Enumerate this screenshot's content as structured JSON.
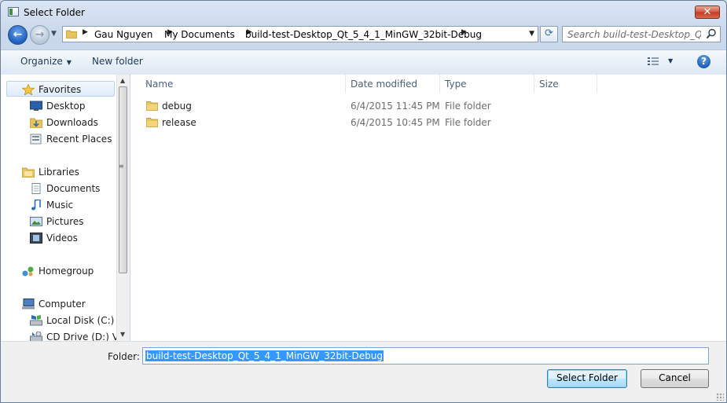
{
  "window": {
    "title": "Select Folder",
    "close_symbol": "✕"
  },
  "nav": {
    "back_symbol": "←",
    "forward_symbol": "→"
  },
  "address": {
    "crumbs": [
      "Gau Nguyen",
      "My Documents",
      "build-test-Desktop_Qt_5_4_1_MinGW_32bit-Debug"
    ]
  },
  "search": {
    "placeholder": "Search build-test-Desktop_Qt_..."
  },
  "toolbar": {
    "organize_label": "Organize",
    "new_folder_label": "New folder",
    "help_symbol": "?"
  },
  "nav_pane": {
    "favorites": {
      "label": "Favorites",
      "items": [
        "Desktop",
        "Downloads",
        "Recent Places"
      ]
    },
    "libraries": {
      "label": "Libraries",
      "items": [
        "Documents",
        "Music",
        "Pictures",
        "Videos"
      ]
    },
    "homegroup": {
      "label": "Homegroup"
    },
    "computer": {
      "label": "Computer",
      "items": [
        "Local Disk (C:)",
        "CD Drive (D:) Virt"
      ]
    }
  },
  "file_list": {
    "columns": [
      "Name",
      "Date modified",
      "Type",
      "Size"
    ],
    "rows": [
      {
        "name": "debug",
        "date": "6/4/2015 11:45 PM",
        "type": "File folder"
      },
      {
        "name": "release",
        "date": "6/4/2015 10:45 PM",
        "type": "File folder"
      }
    ]
  },
  "footer": {
    "folder_label": "Folder:",
    "folder_value": "build-test-Desktop_Qt_5_4_1_MinGW_32bit-Debug",
    "select_button": "Select Folder",
    "cancel_button": "Cancel"
  },
  "colors": {
    "accent": "#3399ff",
    "window_frame": "#c4d4e8",
    "close": "#c23a20"
  },
  "icons": [
    "window-icon",
    "close-icon",
    "back-icon",
    "forward-icon",
    "folder-icon",
    "refresh-icon",
    "search-icon",
    "view-icon",
    "help-icon",
    "star-icon",
    "desktop-icon",
    "downloads-icon",
    "recent-places-icon",
    "libraries-icon",
    "documents-icon",
    "music-icon",
    "pictures-icon",
    "videos-icon",
    "homegroup-icon",
    "computer-icon",
    "disk-icon",
    "cd-drive-icon"
  ]
}
